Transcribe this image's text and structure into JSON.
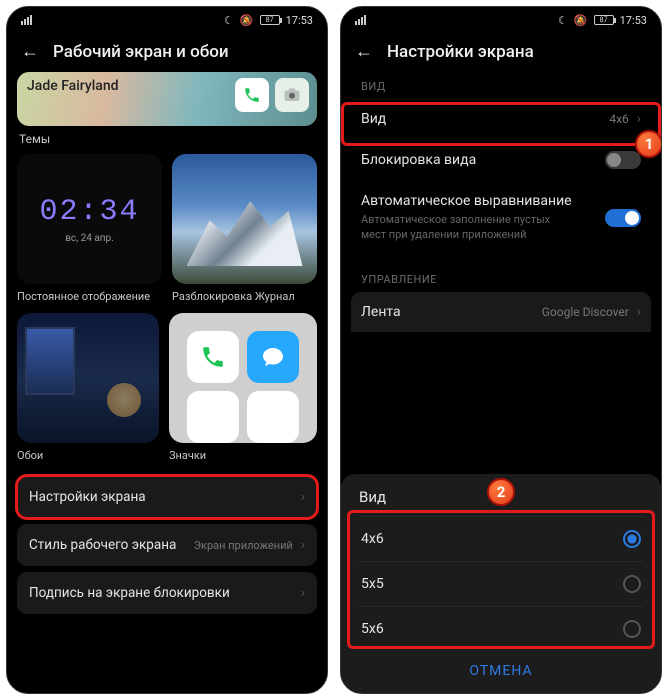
{
  "statusbar": {
    "time": "17:53",
    "battery": "87"
  },
  "left": {
    "title": "Рабочий экран и обои",
    "banner_title": "Jade Fairyland",
    "themes_label": "Темы",
    "clock_time": "02:34",
    "clock_date": "вс, 24 апр.",
    "tile1_caption": "Постоянное отображение",
    "tile2_caption": "Разблокировка Журнал",
    "tile3_caption": "Обои",
    "tile4_caption": "Значки",
    "row1": "Настройки экрана",
    "row2": "Стиль рабочего экрана",
    "row2_sub": "Экран приложений",
    "row3": "Подпись на экране блокировки"
  },
  "right": {
    "title": "Настройки экрана",
    "section_view": "ВИД",
    "row_view": "Вид",
    "row_view_val": "4x6",
    "row_lock": "Блокировка вида",
    "row_align": "Автоматическое выравнивание",
    "row_align_desc": "Автоматическое заполнение пустых мест при удалении приложений",
    "section_manage": "УПРАВЛЕНИЕ",
    "row_feed": "Лента",
    "row_feed_val": "Google Discover",
    "sheet_title": "Вид",
    "options": [
      {
        "label": "4x6",
        "selected": true
      },
      {
        "label": "5x5",
        "selected": false
      },
      {
        "label": "5x6",
        "selected": false
      }
    ],
    "cancel": "ОТМЕНА"
  },
  "badges": {
    "one": "1",
    "two": "2"
  }
}
